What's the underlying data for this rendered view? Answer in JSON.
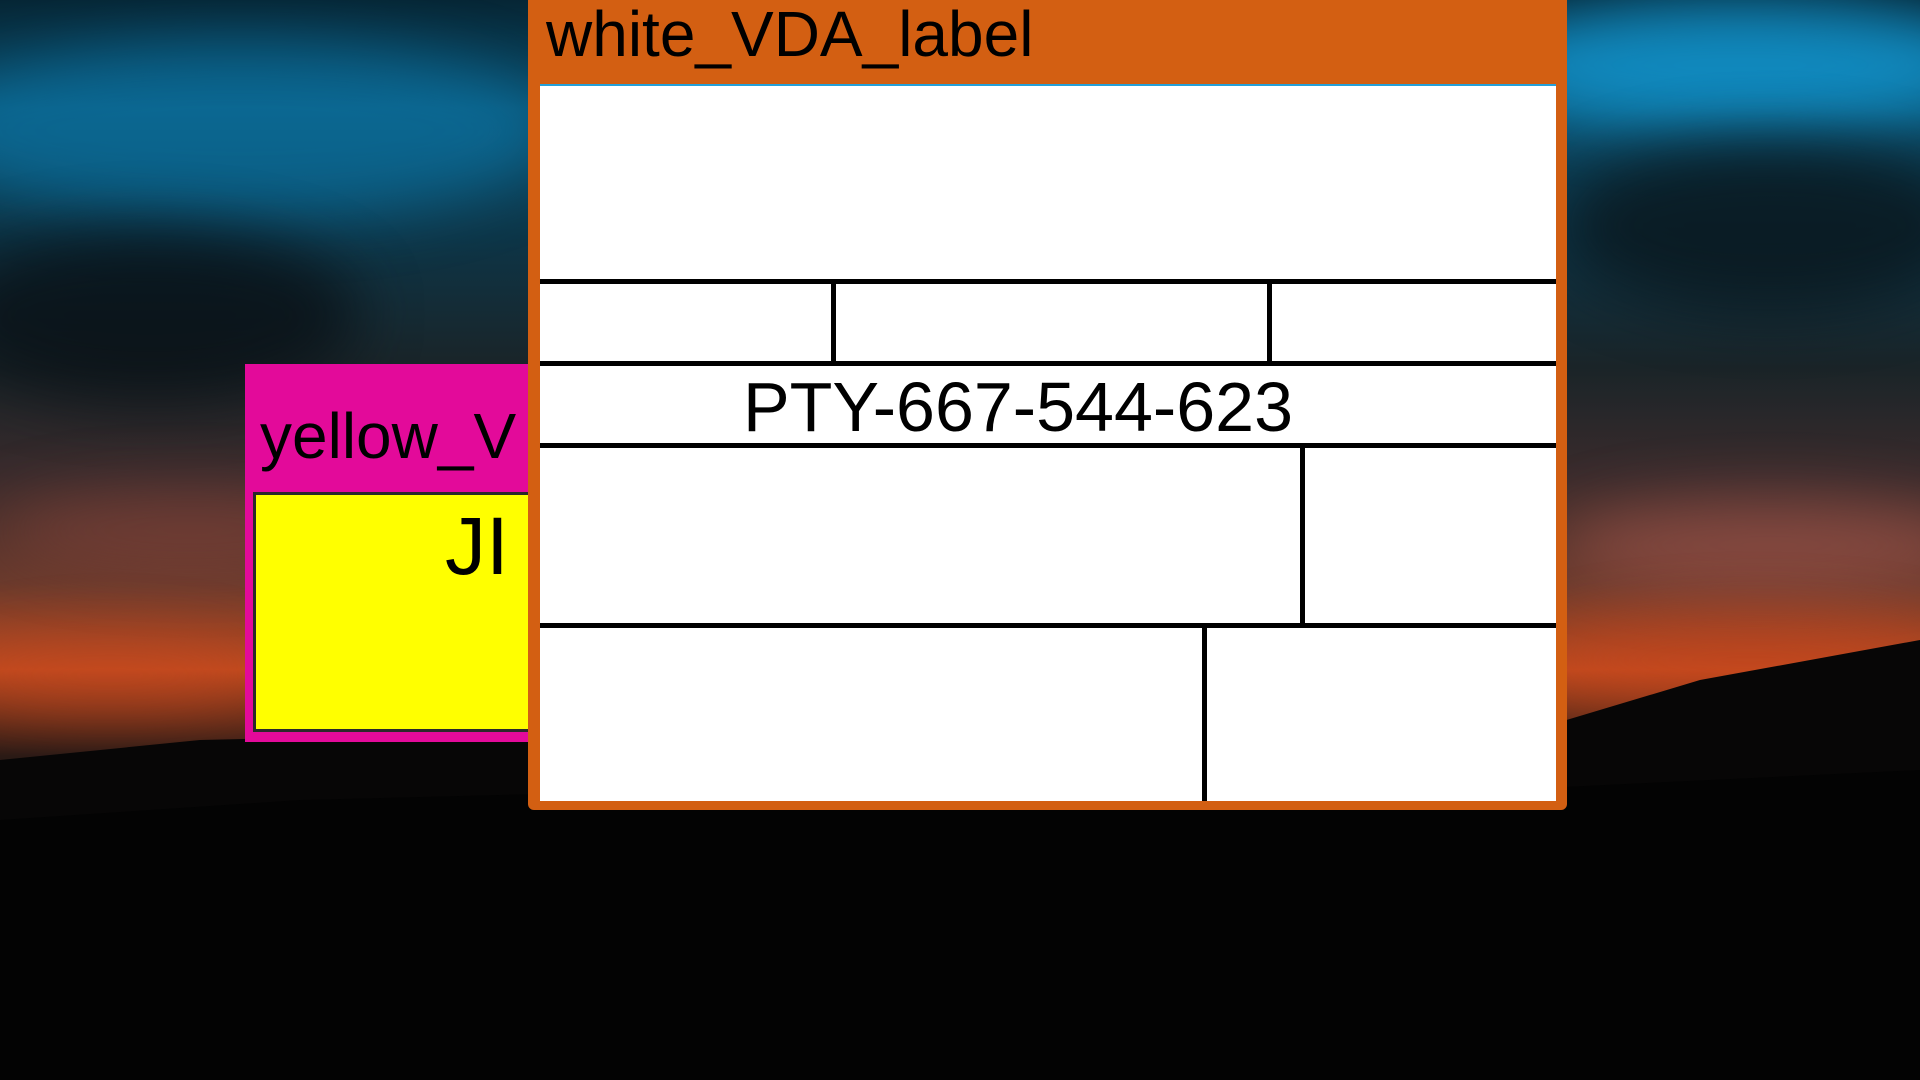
{
  "windows": {
    "yellow": {
      "title": "yellow_V",
      "body_text": "JI",
      "title_bar_color": "#e30a9a",
      "body_color": "#ffff00"
    },
    "white": {
      "title": "white_VDA_label",
      "tracking_number": "PTY-667-544-623",
      "title_bar_color": "#d35f12",
      "body_color": "#ffffff"
    }
  }
}
